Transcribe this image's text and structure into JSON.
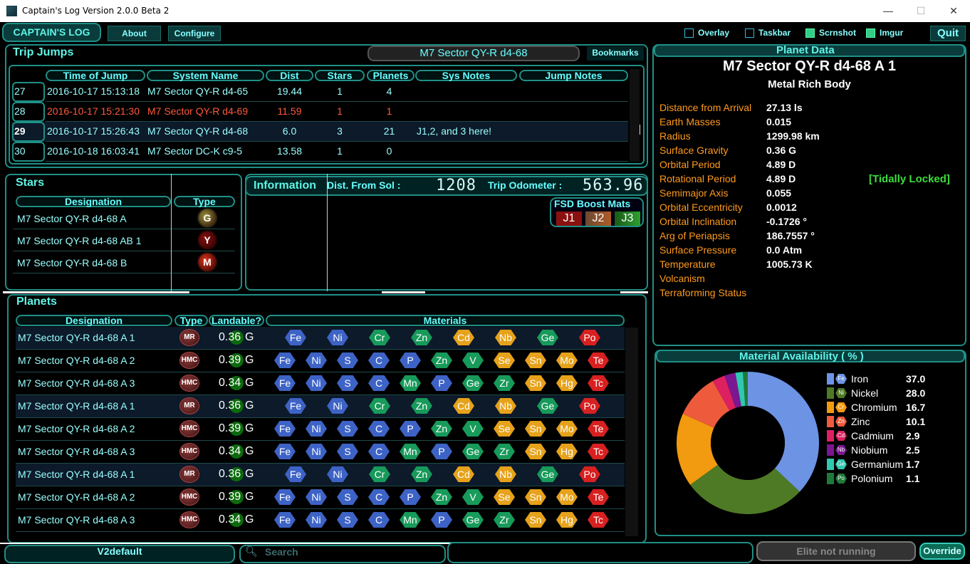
{
  "window": {
    "title": "Captain's Log Version 2.0.0 Beta 2",
    "minimize": "—",
    "maximize": "☐",
    "close": "✕"
  },
  "toolbar": {
    "brand": "CAPTAIN'S LOG",
    "about": "About",
    "configure": "Configure",
    "toggles": [
      {
        "label": "Overlay",
        "checked": false
      },
      {
        "label": "Taskbar",
        "checked": false
      },
      {
        "label": "Scrnshot",
        "checked": true
      },
      {
        "label": "Imgur",
        "checked": true
      }
    ],
    "quit": "Quit"
  },
  "trip": {
    "title": "Trip Jumps",
    "current_system": "M7 Sector QY-R d4-68",
    "bookmarks": "Bookmarks",
    "columns": [
      "Time of Jump",
      "System Name",
      "Dist",
      "Stars",
      "Planets",
      "Sys Notes",
      "Jump Notes"
    ],
    "rows": [
      {
        "num": "27",
        "time": "2016-10-17 15:13:18",
        "system": "M7 Sector QY-R d4-65",
        "dist": "19.44",
        "stars": "1",
        "planets": "4",
        "sys_notes": "",
        "jump_notes": ""
      },
      {
        "num": "28",
        "time": "2016-10-17 15:21:30",
        "system": "M7 Sector QY-R d4-69",
        "dist": "11.59",
        "stars": "1",
        "planets": "1",
        "sys_notes": "",
        "jump_notes": ""
      },
      {
        "num": "29",
        "time": "2016-10-17 15:26:43",
        "system": "M7 Sector QY-R d4-68",
        "dist": "6.0",
        "stars": "3",
        "planets": "21",
        "sys_notes": "J1,2, and 3 here!",
        "jump_notes": ""
      },
      {
        "num": "30",
        "time": "2016-10-18 16:03:41",
        "system": "M7 Sector DC-K c9-5",
        "dist": "13.58",
        "stars": "1",
        "planets": "0",
        "sys_notes": "",
        "jump_notes": ""
      }
    ]
  },
  "stars": {
    "title": "Stars",
    "columns": [
      "Designation",
      "Type"
    ],
    "rows": [
      {
        "name": "M7 Sector QY-R d4-68 A",
        "type": "G",
        "color": "#9a9640"
      },
      {
        "name": "M7 Sector QY-R d4-68 AB 1",
        "type": "Y",
        "color": "#8a1010"
      },
      {
        "name": "M7 Sector QY-R d4-68 B",
        "type": "M",
        "color": "#e8341a"
      }
    ]
  },
  "info": {
    "title": "Information",
    "dist_label": "Dist. From Sol :",
    "dist_value": "1208",
    "odo_label": "Trip Odometer :",
    "odo_value": "563.96",
    "fsd_title": "FSD Boost Mats",
    "fsd": [
      "J1",
      "J2",
      "J3"
    ]
  },
  "planets": {
    "title": "Planets",
    "columns": [
      "Designation",
      "Type",
      "Landable?",
      "Materials"
    ],
    "rows": [
      {
        "name": "M7 Sector QY-R d4-68 A 1",
        "type": "MR",
        "grav": "0.36",
        "unit": "G",
        "mats": [
          "Fe",
          "Ni",
          "Cr",
          "Zn",
          "Cd",
          "Nb",
          "Ge",
          "Po"
        ],
        "highlight": true
      },
      {
        "name": "M7 Sector QY-R d4-68 A 2",
        "type": "HMC",
        "grav": "0.39",
        "unit": "G",
        "mats": [
          "Fe",
          "Ni",
          "S",
          "C",
          "P",
          "Zn",
          "V",
          "Se",
          "Sn",
          "Mo",
          "Te"
        ],
        "highlight": false
      },
      {
        "name": "M7 Sector QY-R d4-68 A 3",
        "type": "HMC",
        "grav": "0.34",
        "unit": "G",
        "mats": [
          "Fe",
          "Ni",
          "S",
          "C",
          "Mn",
          "P",
          "Ge",
          "Zr",
          "Sn",
          "Hg",
          "Tc"
        ],
        "highlight": false
      },
      {
        "name": "M7 Sector QY-R d4-68 A 1",
        "type": "MR",
        "grav": "0.36",
        "unit": "G",
        "mats": [
          "Fe",
          "Ni",
          "Cr",
          "Zn",
          "Cd",
          "Nb",
          "Ge",
          "Po"
        ],
        "highlight": true
      },
      {
        "name": "M7 Sector QY-R d4-68 A 2",
        "type": "HMC",
        "grav": "0.39",
        "unit": "G",
        "mats": [
          "Fe",
          "Ni",
          "S",
          "C",
          "P",
          "Zn",
          "V",
          "Se",
          "Sn",
          "Mo",
          "Te"
        ],
        "highlight": false
      },
      {
        "name": "M7 Sector QY-R d4-68 A 3",
        "type": "HMC",
        "grav": "0.34",
        "unit": "G",
        "mats": [
          "Fe",
          "Ni",
          "S",
          "C",
          "Mn",
          "P",
          "Ge",
          "Zr",
          "Sn",
          "Hg",
          "Tc"
        ],
        "highlight": false
      },
      {
        "name": "M7 Sector QY-R d4-68 A 1",
        "type": "MR",
        "grav": "0.36",
        "unit": "G",
        "mats": [
          "Fe",
          "Ni",
          "Cr",
          "Zn",
          "Cd",
          "Nb",
          "Ge",
          "Po"
        ],
        "highlight": true
      },
      {
        "name": "M7 Sector QY-R d4-68 A 2",
        "type": "HMC",
        "grav": "0.39",
        "unit": "G",
        "mats": [
          "Fe",
          "Ni",
          "S",
          "C",
          "P",
          "Zn",
          "V",
          "Se",
          "Sn",
          "Mo",
          "Te"
        ],
        "highlight": false
      },
      {
        "name": "M7 Sector QY-R d4-68 A 3",
        "type": "HMC",
        "grav": "0.34",
        "unit": "G",
        "mats": [
          "Fe",
          "Ni",
          "S",
          "C",
          "Mn",
          "P",
          "Ge",
          "Zr",
          "Sn",
          "Hg",
          "Tc"
        ],
        "highlight": false
      }
    ]
  },
  "mat_colors": {
    "Fe": "#3e63c6",
    "Ni": "#3e63c6",
    "S": "#3e63c6",
    "C": "#3e63c6",
    "P": "#3e63c6",
    "Cr": "#179a5a",
    "Zn": "#179a5a",
    "V": "#179a5a",
    "Mn": "#179a5a",
    "Ge": "#179a5a",
    "Zr": "#179a5a",
    "Cd": "#e6a21a",
    "Nb": "#e6a21a",
    "Se": "#e6a21a",
    "Sn": "#e6a21a",
    "Mo": "#e6a21a",
    "Hg": "#e6a21a",
    "Po": "#d82020",
    "Te": "#d82020",
    "Tc": "#d82020"
  },
  "planet_data": {
    "title": "Planet Data",
    "name": "M7 Sector QY-R d4-68 A 1",
    "class": "Metal Rich Body",
    "fields": [
      {
        "label": "Distance from Arrival",
        "value": "27.13 ls"
      },
      {
        "label": "Earth Masses",
        "value": "0.015"
      },
      {
        "label": "Radius",
        "value": "1299.98 km"
      },
      {
        "label": "Surface Gravity",
        "value": "0.36 G"
      },
      {
        "label": "Orbital Period",
        "value": "4.89 D"
      },
      {
        "label": "Rotational  Period",
        "value": "4.89 D"
      },
      {
        "label": "Semimajor Axis",
        "value": "0.055"
      },
      {
        "label": "Orbital Eccentricity",
        "value": "0.0012"
      },
      {
        "label": "Orbital Inclination",
        "value": "-0.1726 °"
      },
      {
        "label": "Arg of Periapsis",
        "value": "186.7557 °"
      },
      {
        "label": "Surface Pressure",
        "value": "0.0 Atm"
      },
      {
        "label": "Temperature",
        "value": "1005.73 K"
      },
      {
        "label": "Volcanism",
        "value": ""
      },
      {
        "label": "Terraforming Status",
        "value": ""
      }
    ],
    "tidal": "[Tidally Locked]"
  },
  "chart_data": {
    "type": "pie",
    "title": "Material Availability ( % )",
    "categories": [
      "Iron",
      "Nickel",
      "Chromium",
      "Zinc",
      "Cadmium",
      "Niobium",
      "Germanium",
      "Polonium"
    ],
    "symbols": [
      "Fe",
      "Ni",
      "Cr",
      "Zn",
      "Cd",
      "Nb",
      "Ge",
      "Po"
    ],
    "values": [
      37.0,
      28.0,
      16.7,
      10.1,
      2.9,
      2.5,
      1.7,
      1.1
    ],
    "labels": [
      "37.0",
      "28.0",
      "16.7",
      "10.1",
      "2.9",
      "2.5",
      "1.7",
      "1.1"
    ],
    "colors": [
      "#6d93e4",
      "#4e7a25",
      "#f29a10",
      "#ee5a3c",
      "#dd2060",
      "#7b1790",
      "#30c8b0",
      "#1f7a3a"
    ],
    "legend": "right"
  },
  "bottom": {
    "profile": "V2default",
    "search_placeholder": "Search",
    "status": "Elite not running",
    "override": "Override"
  }
}
